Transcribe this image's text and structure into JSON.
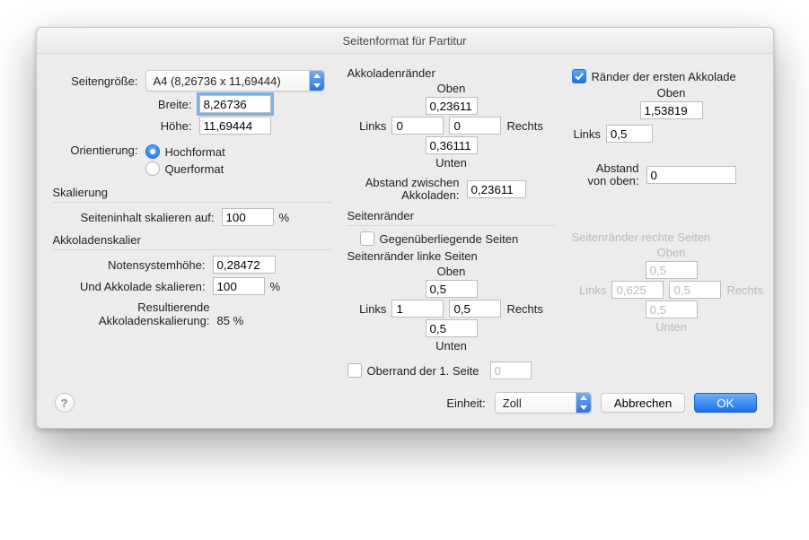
{
  "title": "Seitenformat für Partitur",
  "left": {
    "pageSizeLabel": "Seitengröße:",
    "pageSizeValue": "A4 (8,26736 x 11,69444)",
    "widthLabel": "Breite:",
    "widthValue": "8,26736",
    "heightLabel": "Höhe:",
    "heightValue": "11,69444",
    "orientLabel": "Orientierung:",
    "portrait": "Hochformat",
    "landscape": "Querformat",
    "scalingGroup": "Skalierung",
    "scaleContentLabel": "Seiteninhalt skalieren auf:",
    "scaleContentValue": "100",
    "percent": "%",
    "systemScalingGroup": "Akkoladenskalier",
    "staffHeightLabel": "Notensystemhöhe:",
    "staffHeightValue": "0,28472",
    "scaleSystemLabel": "Und Akkolade skalieren:",
    "scaleSystemValue": "100",
    "resultLabel1": "Resultierende",
    "resultLabel2": "Akkoladenskalierung:",
    "resultValue": "85 %"
  },
  "mid": {
    "group": "Akkoladenränder",
    "top": "Oben",
    "bottom": "Unten",
    "left": "Links",
    "right": "Rechts",
    "topVal": "0,23611",
    "leftVal": "0",
    "rightVal": "0",
    "bottomVal": "0,36111",
    "gapLabel": "Abstand zwischen\nAkkoladen:",
    "gapValue": "0,23611",
    "pmGroup": "Seitenränder",
    "facing": "Gegenüberliegende Seiten",
    "leftPages": "Seitenränder linke Seiten",
    "lpTop": "0,5",
    "lpLeft": "1",
    "lpRight": "0,5",
    "lpBottom": "0,5",
    "firstTop": "Oberrand der 1. Seite",
    "firstTopVal": "0"
  },
  "right": {
    "firstSys": "Ränder der ersten Akkolade",
    "top": "Oben",
    "left": "Links",
    "fsTop": "1,53819",
    "fsLeft": "0,5",
    "fromTopLabel": "Abstand\nvon oben:",
    "fromTopVal": "0",
    "rightPages": "Seitenränder rechte Seiten",
    "rpTop": "0,5",
    "rpLeft": "0,625",
    "rpRight": "0,5",
    "rpBottom": "0,5"
  },
  "footer": {
    "unitLabel": "Einheit:",
    "unitValue": "Zoll",
    "cancel": "Abbrechen",
    "ok": "OK"
  }
}
